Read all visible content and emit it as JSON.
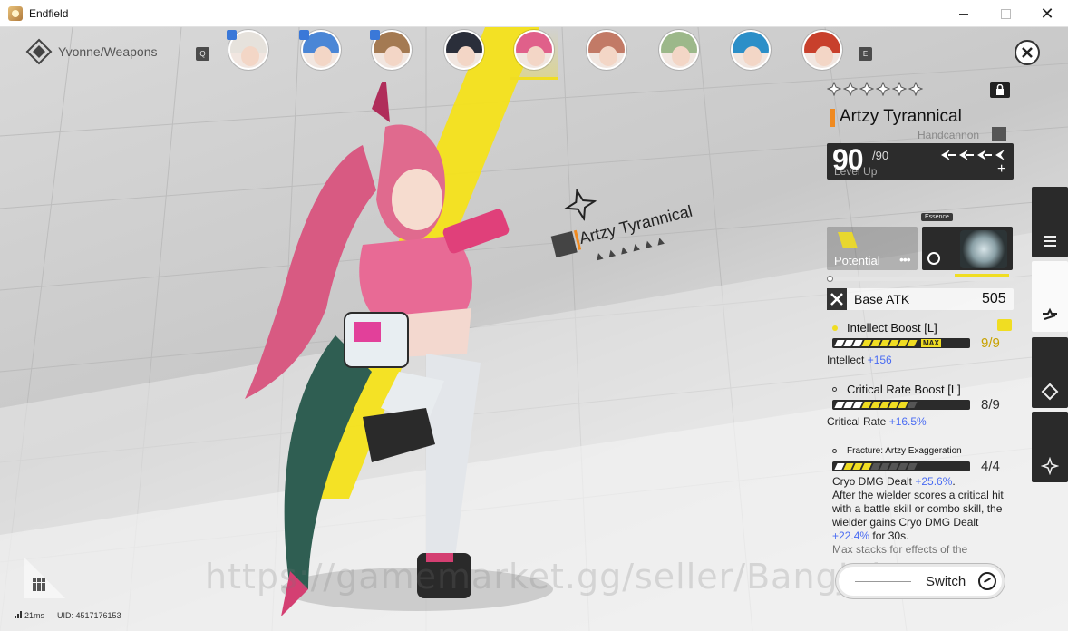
{
  "window": {
    "title": "Endfield",
    "close_glyph": "✕"
  },
  "header": {
    "breadcrumb": "Yvonne/Weapons",
    "breadcrumb_icon": "endfield-logo-icon",
    "key_left": "Q",
    "key_right": "E",
    "close_icon": "close-icon"
  },
  "roster": [
    {
      "name": "portrait-1",
      "hair": "#e6e2dc",
      "badge": true
    },
    {
      "name": "portrait-2",
      "hair": "#4a86d6",
      "badge": true
    },
    {
      "name": "portrait-3",
      "hair": "#a47a52",
      "badge": true
    },
    {
      "name": "portrait-4",
      "hair": "#2a2e3a",
      "badge": false
    },
    {
      "name": "portrait-5",
      "hair": "#e0608a",
      "badge": false,
      "selected": true
    },
    {
      "name": "portrait-6",
      "hair": "#c27a66",
      "badge": false
    },
    {
      "name": "portrait-7",
      "hair": "#9cb88a",
      "badge": false
    },
    {
      "name": "portrait-8",
      "hair": "#2c8fc8",
      "badge": false
    },
    {
      "name": "portrait-9",
      "hair": "#c8402c",
      "badge": false
    }
  ],
  "floating_label": {
    "name": "Artzy Tyrannical"
  },
  "weapon": {
    "name": "Artzy Tyrannical",
    "type": "Handcannon",
    "level": "90",
    "level_max": "/90",
    "level_label": "Level Up",
    "plus": "+",
    "potential_label": "Potential",
    "potential_dots": "•••",
    "essence_tag": "Essence",
    "base_atk_label": "Base ATK",
    "base_atk_value": "505",
    "rarity_stars": 6,
    "accent": "#f08a20"
  },
  "stats": [
    {
      "title": "Intellect Boost [L]",
      "count": "9/9",
      "filled": 9,
      "max_tag": "MAX",
      "desc_prefix": "Intellect ",
      "desc_value": "+156"
    },
    {
      "title": "Critical Rate Boost [L]",
      "count": "8/9",
      "filled": 8,
      "desc_prefix": "Critical Rate ",
      "desc_value": "+16.5%"
    },
    {
      "title": "Fracture: Artzy Exaggeration",
      "count": "4/4",
      "filled": 4,
      "desc_line1_prefix": "Cryo DMG Dealt ",
      "desc_line1_value": "+25.6%",
      "desc_line1_suffix": ".",
      "desc_body": "After the wielder scores a critical hit with a battle skill or combo skill, the wielder gains Cryo DMG Dealt ",
      "desc_body_value": "+22.4%",
      "desc_body_suffix": " for 30s.",
      "desc_cut": "Max stacks for effects of the"
    }
  ],
  "side_tabs": [
    {
      "name": "tab-list",
      "icon": "list-icon",
      "active": false
    },
    {
      "name": "tab-weapon",
      "icon": "weapon-icon",
      "active": true
    },
    {
      "name": "tab-gear",
      "icon": "gear-diamond-icon",
      "active": false
    },
    {
      "name": "tab-skill",
      "icon": "shuriken-icon",
      "active": false
    }
  ],
  "bottom": {
    "latency": "21ms",
    "uid": "UID: 4517176153",
    "switch_label": "Switch",
    "watermark": "https://gamemarket.gg/seller/BangJoh"
  }
}
